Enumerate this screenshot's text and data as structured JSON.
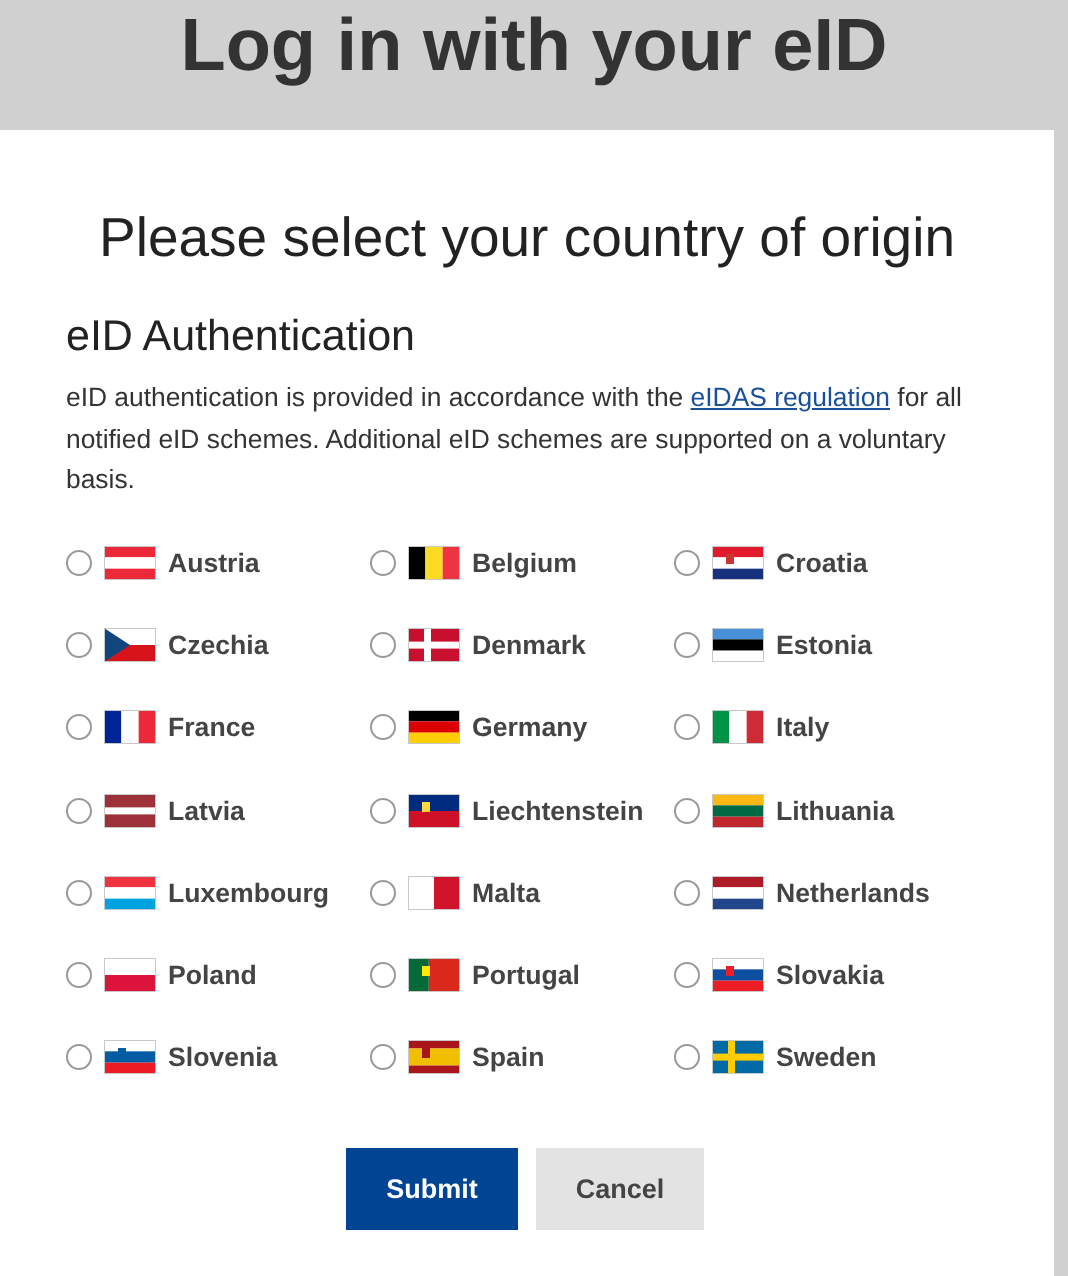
{
  "header": {
    "title": "Log in with your eID"
  },
  "card": {
    "heading": "Please select your country of origin",
    "section_title": "eID Authentication",
    "intro": {
      "before": "eID authentication is provided in accordance with the ",
      "link": "eIDAS regulation",
      "after": " for all notified eID schemes. Additional eID schemes are supported on a voluntary basis."
    },
    "countries": [
      {
        "label": "Austria",
        "selected": false
      },
      {
        "label": "Belgium",
        "selected": false
      },
      {
        "label": "Croatia",
        "selected": false
      },
      {
        "label": "Czechia",
        "selected": false
      },
      {
        "label": "Denmark",
        "selected": false
      },
      {
        "label": "Estonia",
        "selected": false
      },
      {
        "label": "France",
        "selected": false
      },
      {
        "label": "Germany",
        "selected": false
      },
      {
        "label": "Italy",
        "selected": false
      },
      {
        "label": "Latvia",
        "selected": false
      },
      {
        "label": "Liechtenstein",
        "selected": false
      },
      {
        "label": "Lithuania",
        "selected": false
      },
      {
        "label": "Luxembourg",
        "selected": false
      },
      {
        "label": "Malta",
        "selected": false
      },
      {
        "label": "Netherlands",
        "selected": false
      },
      {
        "label": "Poland",
        "selected": false
      },
      {
        "label": "Portugal",
        "selected": false
      },
      {
        "label": "Slovakia",
        "selected": false
      },
      {
        "label": "Slovenia",
        "selected": false
      },
      {
        "label": "Spain",
        "selected": false
      },
      {
        "label": "Sweden",
        "selected": false
      }
    ],
    "buttons": [
      {
        "label": "Submit",
        "kind": "primary"
      },
      {
        "label": "Cancel",
        "kind": "secondary"
      }
    ]
  }
}
